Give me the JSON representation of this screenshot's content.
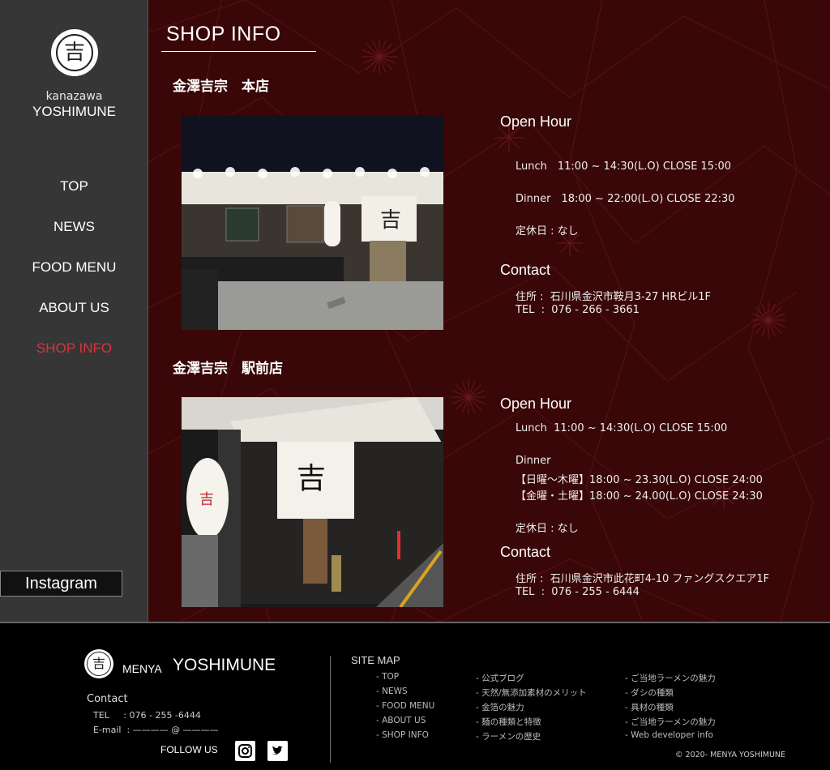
{
  "sidebar": {
    "logo_glyph": "吉",
    "brand_sub": "kanazawa",
    "brand_main": "YOSHIMUNE",
    "nav": [
      "TOP",
      "NEWS",
      "FOOD MENU",
      "ABOUT US",
      "SHOP INFO"
    ],
    "active_nav": "SHOP INFO",
    "instagram_label": "Instagram"
  },
  "main": {
    "title": "SHOP INFO",
    "shops": [
      {
        "name": "金澤吉宗　本店",
        "open_hour_heading": "Open Hour",
        "hours": [
          "Lunch　11:00 ~ 14:30(L.O) CLOSE 15:00",
          "Dinner　18:00 ~ 22:00(L.O) CLOSE 22:30",
          "定休日 : なし"
        ],
        "contact_heading": "Contact",
        "contact": [
          "住所 :  石川県金沢市鞍月3-27 HRビル1F",
          "TEL  :  076 - 266 - 3661"
        ]
      },
      {
        "name": "金澤吉宗　駅前店",
        "open_hour_heading": "Open Hour",
        "hours": [
          "Lunch  11:00 ~ 14:30(L.O) CLOSE 15:00",
          "Dinner",
          "【日曜〜木曜】18:00 ~ 23.30(L.O) CLOSE 24:00",
          "【金曜・土曜】18:00 ~ 24.00(L.O) CLOSE 24:30",
          "定休日 : なし"
        ],
        "contact_heading": "Contact",
        "contact": [
          "住所 :  石川県金沢市此花町4-10 ファングスクエア1F",
          "TEL  :  076 - 255 - 6444"
        ]
      }
    ]
  },
  "footer": {
    "brand_small": "MENYA",
    "brand_large": "YOSHIMUNE",
    "contact_heading": "Contact",
    "tel": "TEL     : 076 - 255 -6444",
    "email": "E-mail  : ———— @ ————",
    "follow_label": "FOLLOW US",
    "sitemap_heading": "SITE MAP",
    "sitemap_col1": [
      "- TOP",
      "- NEWS",
      "- FOOD MENU",
      "- ABOUT US",
      "- SHOP INFO"
    ],
    "sitemap_col2": [
      "- 公式ブログ",
      "- 天然/無添加素材のメリット",
      "- 金箔の魅力",
      "- 麺の種類と特徴",
      "- ラーメンの歴史"
    ],
    "sitemap_col3": [
      "- ご当地ラーメンの魅力",
      "- ダシの種類",
      "- 具材の種類",
      "- ご当地ラーメンの魅力",
      "- Web developer info"
    ],
    "copyright": "© 2020- MENYA YOSHIMUNE"
  },
  "colors": {
    "main_bg": "#3a0708",
    "sidebar_bg": "#363636",
    "active_nav": "#d8333a"
  }
}
